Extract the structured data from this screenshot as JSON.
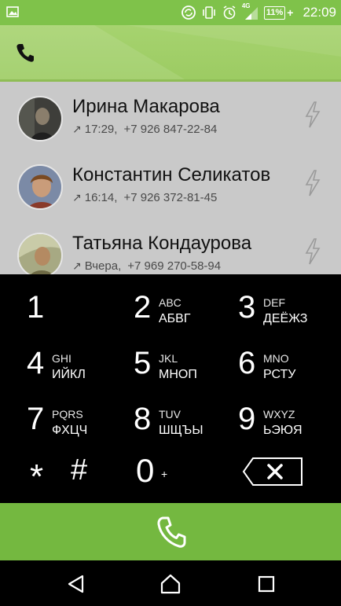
{
  "status_bar": {
    "time": "22:09",
    "battery_percent": "11%",
    "network": "4G",
    "icons": [
      "image-icon",
      "sync-icon",
      "vibrate-icon",
      "alarm-icon",
      "signal-icon",
      "battery-icon",
      "charging-icon"
    ]
  },
  "header": {
    "icon": "phone-icon"
  },
  "call_log": [
    {
      "name": "Ирина Макарова",
      "direction": "↗",
      "time": "17:29,",
      "number": "+7 926 847-22-84",
      "action_icon": "flash-icon"
    },
    {
      "name": "Константин Селикатов",
      "direction": "↗",
      "time": "16:14,",
      "number": "+7 926 372-81-45",
      "action_icon": "flash-icon"
    },
    {
      "name": "Татьяна Кондаурова",
      "direction": "↗",
      "time": "Вчера,",
      "number": "+7 969 270-58-94",
      "action_icon": "flash-icon"
    }
  ],
  "dialpad": {
    "keys": [
      {
        "digit": "1",
        "latin": "",
        "cyrillic": ""
      },
      {
        "digit": "2",
        "latin": "ABC",
        "cyrillic": "АБВГ"
      },
      {
        "digit": "3",
        "latin": "DEF",
        "cyrillic": "ДЕЁЖЗ"
      },
      {
        "digit": "4",
        "latin": "GHI",
        "cyrillic": "ИЙКЛ"
      },
      {
        "digit": "5",
        "latin": "JKL",
        "cyrillic": "МНОП"
      },
      {
        "digit": "6",
        "latin": "MNO",
        "cyrillic": "РСТУ"
      },
      {
        "digit": "7",
        "latin": "PQRS",
        "cyrillic": "ФХЦЧ"
      },
      {
        "digit": "8",
        "latin": "TUV",
        "cyrillic": "ШЩЪЫ"
      },
      {
        "digit": "9",
        "latin": "WXYZ",
        "cyrillic": "ЬЭЮЯ"
      }
    ],
    "star": "*",
    "hash": "#",
    "zero": "0",
    "zero_sub": "+",
    "backspace_icon": "backspace-icon"
  },
  "call_button": {
    "icon": "phone-call-icon"
  },
  "nav": {
    "back_icon": "back-icon",
    "home_icon": "home-icon",
    "recents_icon": "recents-icon"
  },
  "colors": {
    "accent": "#74b840",
    "header": "#a6d36f",
    "list_bg": "#c9c9c9",
    "dialpad_bg": "#000000"
  }
}
